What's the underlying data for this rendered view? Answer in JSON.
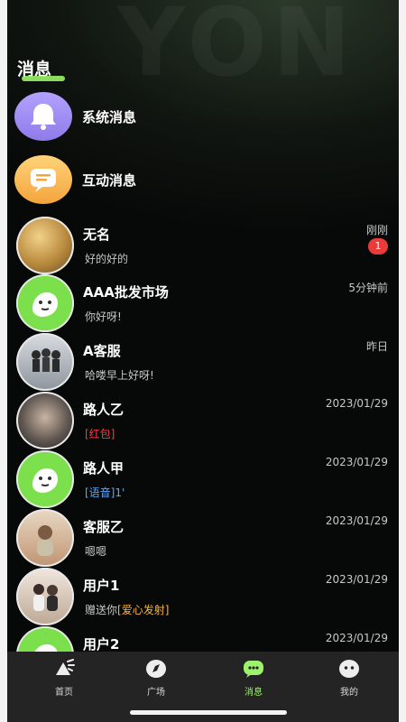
{
  "page": {
    "watermark": "YON",
    "title": "消息"
  },
  "system_rows": [
    {
      "name": "系统消息"
    },
    {
      "name": "互动消息"
    }
  ],
  "chats": [
    {
      "name": "无名",
      "preview": "好的好的",
      "time": "刚刚",
      "badge": "1"
    },
    {
      "name": "AAA批发市场",
      "preview": "你好呀!",
      "time": "5分钟前"
    },
    {
      "name": "A客服",
      "preview": "哈喽早上好呀!",
      "time": "昨日"
    },
    {
      "name": "路人乙",
      "preview": "[红包]",
      "time": "2023/01/29"
    },
    {
      "name": "路人甲",
      "preview": "[语音]1'",
      "time": "2023/01/29"
    },
    {
      "name": "客服乙",
      "preview": "嗯嗯",
      "time": "2023/01/29"
    },
    {
      "name": "用户1",
      "preview_prefix": "赠送你",
      "preview_gift": "[爱心发射]",
      "time": "2023/01/29"
    },
    {
      "name": "用户2",
      "preview": "",
      "time": "2023/01/29"
    }
  ],
  "tabbar": {
    "items": [
      {
        "label": "首页",
        "icon": "home-icon"
      },
      {
        "label": "广场",
        "icon": "compass-icon"
      },
      {
        "label": "消息",
        "icon": "message-icon"
      },
      {
        "label": "我的",
        "icon": "profile-icon"
      }
    ],
    "active_color": "#9cf26c"
  },
  "colors": {
    "accent_green": "#9cf26c",
    "badge_red": "#ea3a3a",
    "system_purple": "#a897f2",
    "interaction_orange": "#f9b45a"
  }
}
